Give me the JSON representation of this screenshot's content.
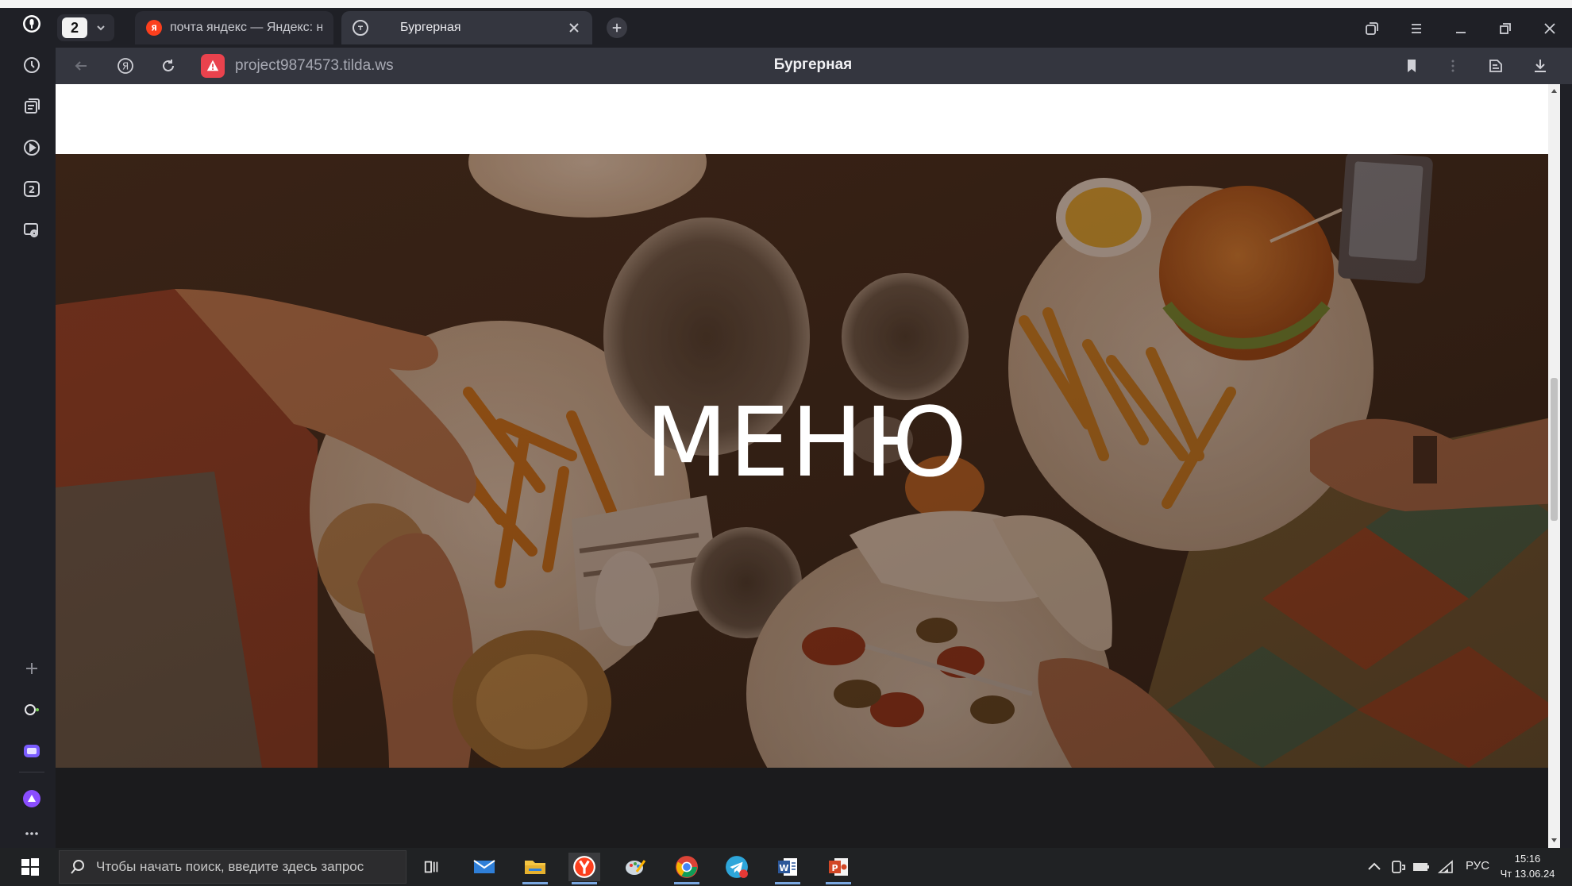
{
  "browser": {
    "tab_count": "2",
    "tabs": [
      {
        "title": "почта яндекс — Яндекс: н",
        "active": false
      },
      {
        "title": "Бургерная",
        "active": true
      }
    ],
    "address": {
      "url": "project9874573.tilda.ws",
      "page_title": "Бургерная"
    },
    "accent_colors": {
      "warning": "#e9424d",
      "yandex_red": "#fc3f1d",
      "tab_bg": "#34363f"
    }
  },
  "page": {
    "hero_title": "МЕНЮ"
  },
  "taskbar": {
    "search_placeholder": "Чтобы начать поиск, введите здесь запрос",
    "apps": [
      "task-view",
      "mail",
      "file-explorer",
      "yandex-browser",
      "paint",
      "chrome",
      "telegram",
      "word",
      "powerpoint"
    ],
    "language": "РУС",
    "time": "15:16",
    "date": "Чт 13.06.24"
  }
}
